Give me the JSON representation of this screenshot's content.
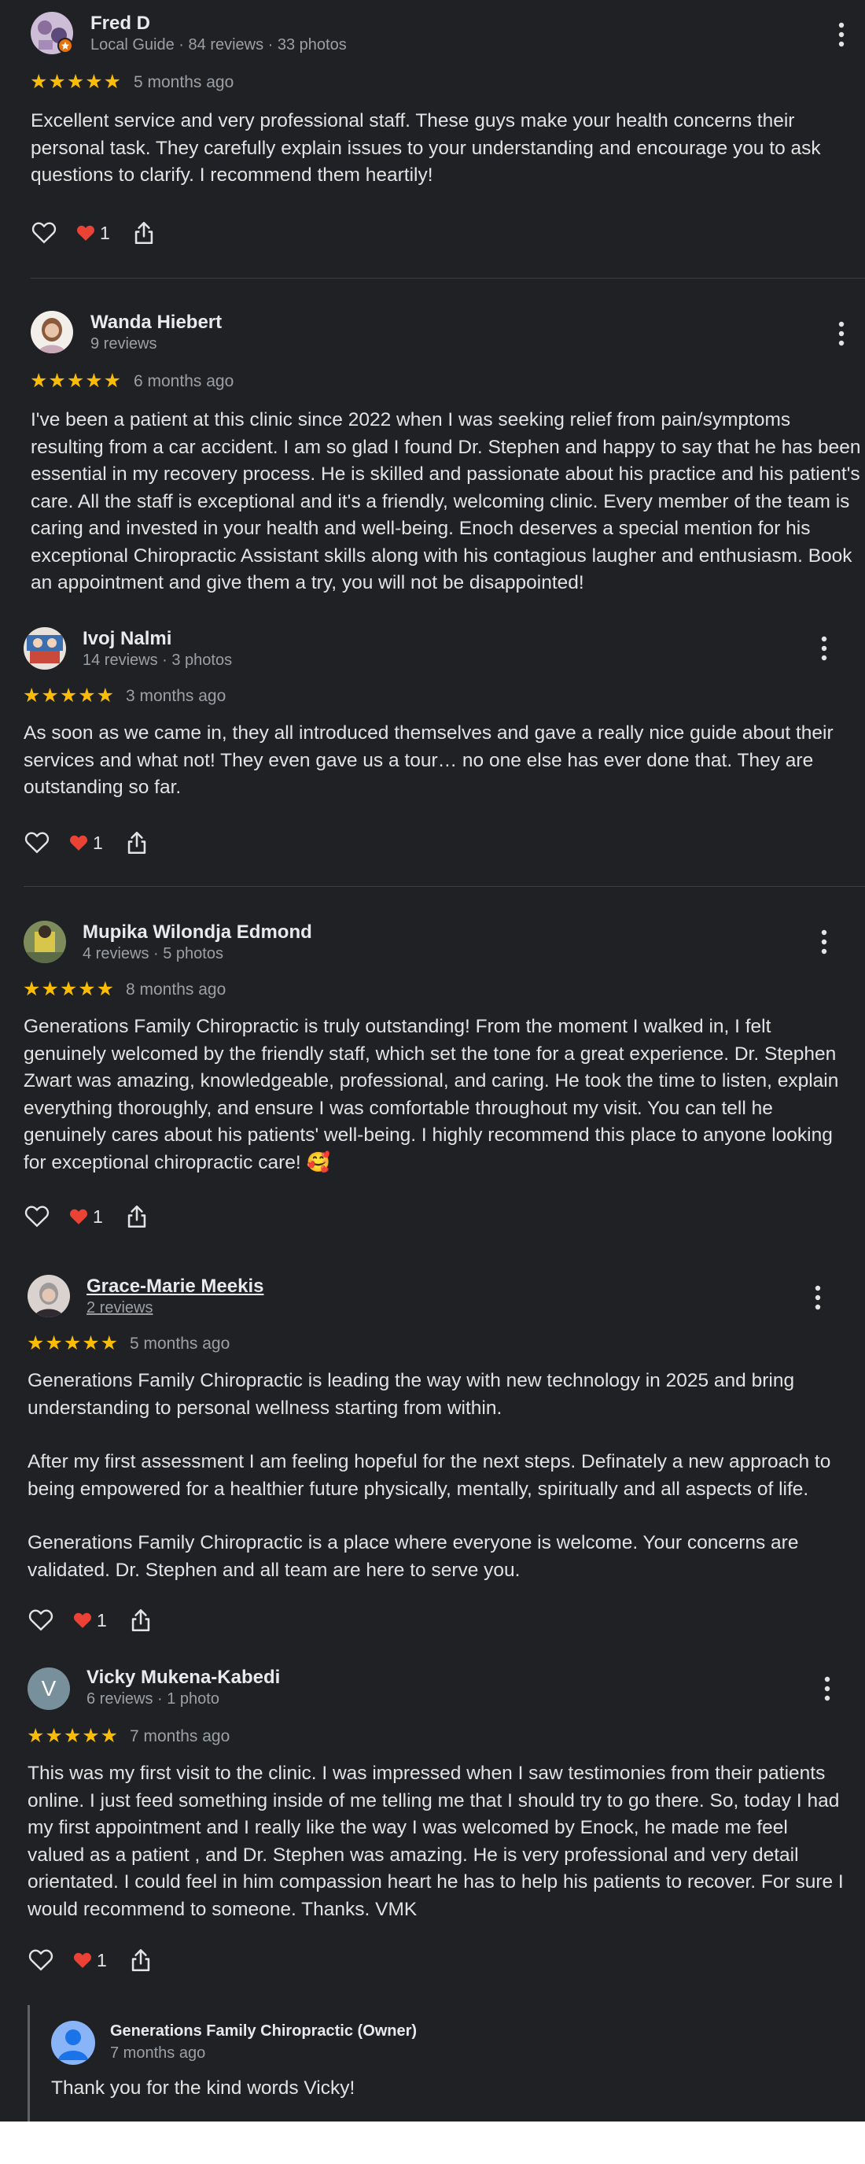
{
  "reviews": [
    {
      "name": "Fred D",
      "meta": "Local Guide · 84 reviews · 33 photos",
      "stars": "★★★★★",
      "time": "5 months ago",
      "paragraphs": [
        "Excellent service and very professional staff. These guys make your health concerns their personal task. They carefully explain issues to your understanding and encourage you to ask questions to clarify. I recommend them heartily!"
      ],
      "reaction_count": "1"
    },
    {
      "name": "Wanda Hiebert",
      "meta": "9 reviews",
      "stars": "★★★★★",
      "time": "6 months ago",
      "paragraphs": [
        "I've been a patient at this clinic since 2022 when I was seeking relief from pain/symptoms resulting from a car accident. I am so glad I found Dr. Stephen and happy to say that he has been essential in my recovery process. He is skilled and passionate about his practice and his patient's care. All the staff is exceptional and it's a friendly, welcoming clinic. Every member of the team is caring and invested in your health and well-being. Enoch deserves a special mention for his exceptional Chiropractic Assistant skills along with his contagious laugher and enthusiasm. Book an appointment and give them a try, you will not be disappointed!"
      ]
    },
    {
      "name": "Ivoj Nalmi",
      "meta": "14 reviews · 3 photos",
      "stars": "★★★★★",
      "time": "3 months ago",
      "paragraphs": [
        "As soon as we came in, they all introduced themselves and gave a really nice guide about their services and what not! They even gave us a tour… no one else has ever done that. They are outstanding so far."
      ],
      "reaction_count": "1"
    },
    {
      "name": "Mupika Wilondja Edmond",
      "meta": "4 reviews · 5 photos",
      "stars": "★★★★★",
      "time": "8 months ago",
      "paragraphs": [
        "Generations Family Chiropractic is truly outstanding! From the moment I walked in, I felt genuinely welcomed by the friendly staff, which set the tone for a great experience. Dr. Stephen Zwart was amazing, knowledgeable, professional, and caring. He took the time to listen, explain everything thoroughly, and ensure I was comfortable throughout my visit. You can tell he genuinely cares about his patients' well-being. I highly recommend this place to anyone looking for exceptional chiropractic care! 🥰"
      ],
      "reaction_count": "1"
    },
    {
      "name": "Grace-Marie Meekis",
      "meta": "2 reviews",
      "stars": "★★★★★",
      "time": "5 months ago",
      "paragraphs": [
        "Generations Family Chiropractic is leading the way with new technology in 2025 and bring understanding to personal wellness starting from within.",
        "After my first assessment I am feeling hopeful for the next steps. Definately a new approach to being empowered for a healthier future physically, mentally, spiritually and all aspects of life.",
        "Generations Family Chiropractic is a place where everyone is welcome. Your concerns are validated. Dr. Stephen and all team are here to serve you."
      ],
      "reaction_count": "1"
    },
    {
      "name": "Vicky Mukena-Kabedi",
      "avatar_letter": "V",
      "meta": "6 reviews · 1 photo",
      "stars": "★★★★★",
      "time": "7 months ago",
      "paragraphs": [
        "This was my first visit to the clinic. I was impressed when I saw testimonies from their patients online. I just feed something inside of me telling me that I should try to go there. So, today I had my first appointment and I really like the way I was welcomed by Enock, he made me feel valued as a patient , and Dr. Stephen was amazing. He is very professional and very detail orientated. I could feel in him compassion heart he has to help his patients to recover. For sure I would recommend to someone. Thanks. VMK"
      ],
      "reaction_count": "1",
      "owner_reply": {
        "name": "Generations Family Chiropractic (Owner)",
        "time": "7 months ago",
        "text": "Thank you for the kind words Vicky!"
      }
    }
  ],
  "colors": {
    "background": "#202124",
    "star": "#fbbc04",
    "heart": "#ea4335",
    "guide_badge": "#e8710a"
  },
  "icons": [
    "heart-outline-icon",
    "heart-reaction-icon",
    "share-icon",
    "more-vert-icon",
    "local-guide-badge-icon"
  ]
}
